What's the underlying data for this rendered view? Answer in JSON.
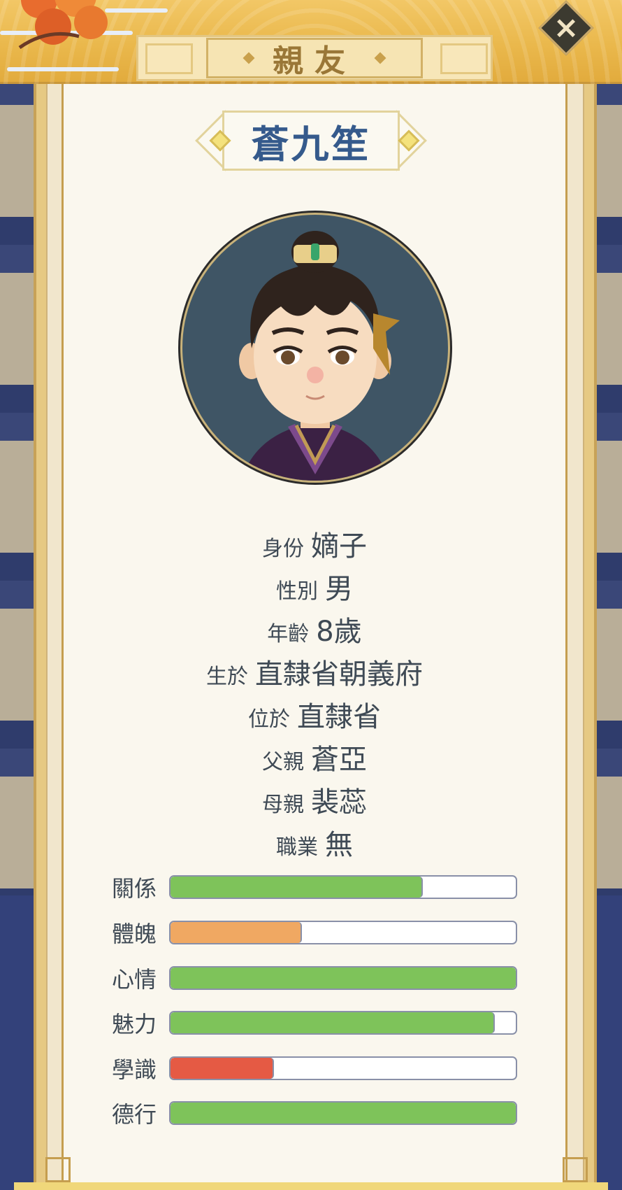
{
  "header": {
    "title": "親友",
    "close_icon": "close-icon"
  },
  "character": {
    "name": "蒼九笙",
    "info": [
      {
        "label": "身份",
        "value": "嫡子"
      },
      {
        "label": "性別",
        "value": "男"
      },
      {
        "label": "年齡",
        "value": "8歲"
      },
      {
        "label": "生於",
        "value": "直隸省朝義府"
      },
      {
        "label": "位於",
        "value": "直隸省"
      },
      {
        "label": "父親",
        "value": "蒼亞"
      },
      {
        "label": "母親",
        "value": "裴蕊"
      },
      {
        "label": "職業",
        "value": "無"
      }
    ],
    "stats": [
      {
        "label": "關係",
        "fraction": 0.73,
        "color": "#7ec35a"
      },
      {
        "label": "體魄",
        "fraction": 0.38,
        "color": "#f0a862"
      },
      {
        "label": "心情",
        "fraction": 1.0,
        "color": "#7ec35a"
      },
      {
        "label": "魅力",
        "fraction": 0.94,
        "color": "#7ec35a"
      },
      {
        "label": "學識",
        "fraction": 0.3,
        "color": "#e55a44"
      },
      {
        "label": "德行",
        "fraction": 1.0,
        "color": "#7ec35a"
      }
    ]
  },
  "colors": {
    "accent_gold": "#c59e4f",
    "name_blue": "#355a8c",
    "paper": "#faf7ee"
  }
}
